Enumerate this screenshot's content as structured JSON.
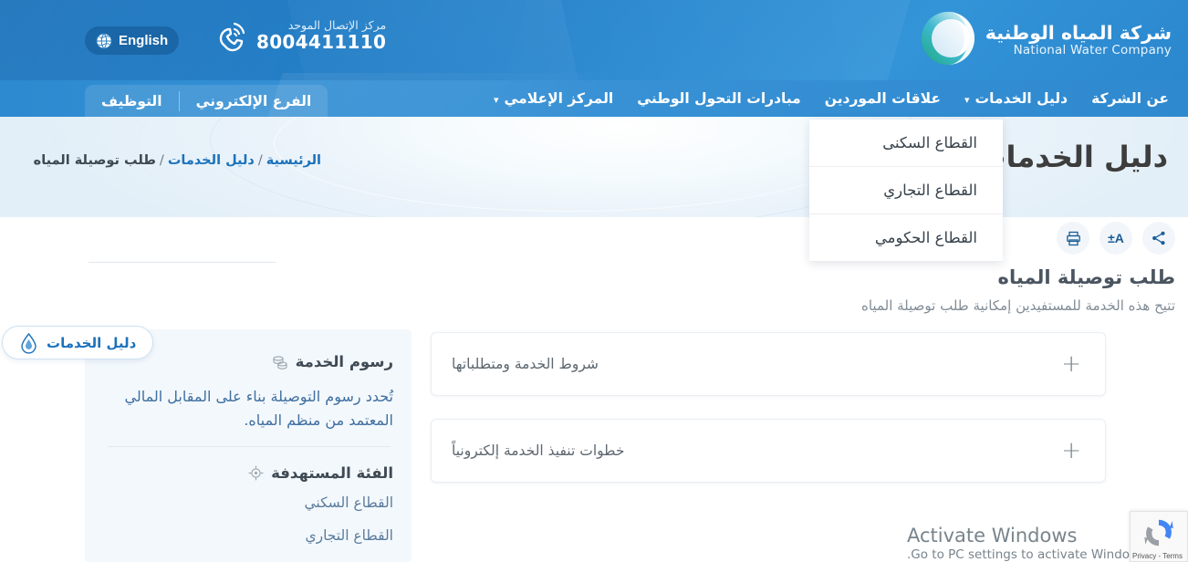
{
  "header": {
    "logo": {
      "arabic": "شركة المياه الوطنية",
      "english": "National Water Company",
      "icon": "nwc-logo-icon"
    },
    "call_center": {
      "label": "مركز الإتصال الموحد",
      "number": "8004411110",
      "icon": "phone-ring-icon"
    },
    "language_button": {
      "label": "English",
      "icon": "globe-icon"
    }
  },
  "nav": {
    "items": [
      {
        "label": "عن الشركة",
        "has_caret": false
      },
      {
        "label": "دليل الخدمات",
        "has_caret": true
      },
      {
        "label": "علاقات الموردين",
        "has_caret": false
      },
      {
        "label": "مبادرات التحول الوطني",
        "has_caret": false
      },
      {
        "label": "المركز الإعلامي",
        "has_caret": true
      }
    ],
    "tabs": [
      {
        "label": "الفرع الإلكتروني"
      },
      {
        "label": "التوظيف"
      }
    ]
  },
  "dropdown": {
    "items": [
      {
        "label": "القطاع السكنى"
      },
      {
        "label": "القطاع التجاري"
      },
      {
        "label": "القطاع الحكومي"
      }
    ]
  },
  "hero": {
    "title": "دليل الخدمات",
    "breadcrumb": {
      "home": "الرئيسية",
      "sep1": "/",
      "section": "دليل الخدمات",
      "sep2": "/",
      "current": "طلب توصيلة المياه"
    }
  },
  "actions": {
    "share": {
      "icon": "share-icon",
      "label": ""
    },
    "font_size": {
      "icon": "font-size-icon",
      "label": "A±"
    },
    "third": {
      "icon": "print-icon",
      "label": ""
    }
  },
  "service": {
    "title": "طلب توصيلة المياه",
    "subtitle": "تتيح هذه الخدمة للمستفيدين إمكانية طلب توصيلة المياه"
  },
  "accordions": [
    {
      "label": "شروط الخدمة ومتطلباتها",
      "toggle": "+"
    },
    {
      "label": "خطوات تنفيذ الخدمة إلكترونياً",
      "toggle": "+"
    }
  ],
  "side_card": {
    "fees": {
      "title": "رسوم الخدمة",
      "icon": "coins-icon",
      "body": "تُحدد رسوم التوصيلة بناء على المقابل المالي المعتمد من منظم المياه."
    },
    "target": {
      "title": "الفئة المستهدفة",
      "icon": "target-icon",
      "items": [
        {
          "label": "القطاع السكني"
        },
        {
          "label": "القطاع التجاري"
        }
      ]
    }
  },
  "floating_pill": {
    "label": "دليل الخدمات",
    "icon": "water-drop-icon"
  },
  "watermark": {
    "line1": "Activate Windows",
    "line2": "Go to PC settings to activate Windows."
  },
  "recaptcha": {
    "icon": "recaptcha-icon",
    "text": "Privacy - Terms"
  },
  "colors": {
    "header_blue_dark": "#1b72bb",
    "header_blue_light": "#3394d8",
    "nav_blue": "#2f89cf",
    "link_blue": "#1b72bb",
    "hero_bg": "#eef5fb",
    "card_bg": "#f3f8fc",
    "body_text": "#5d6770",
    "accent_text": "#3f6fa0"
  }
}
